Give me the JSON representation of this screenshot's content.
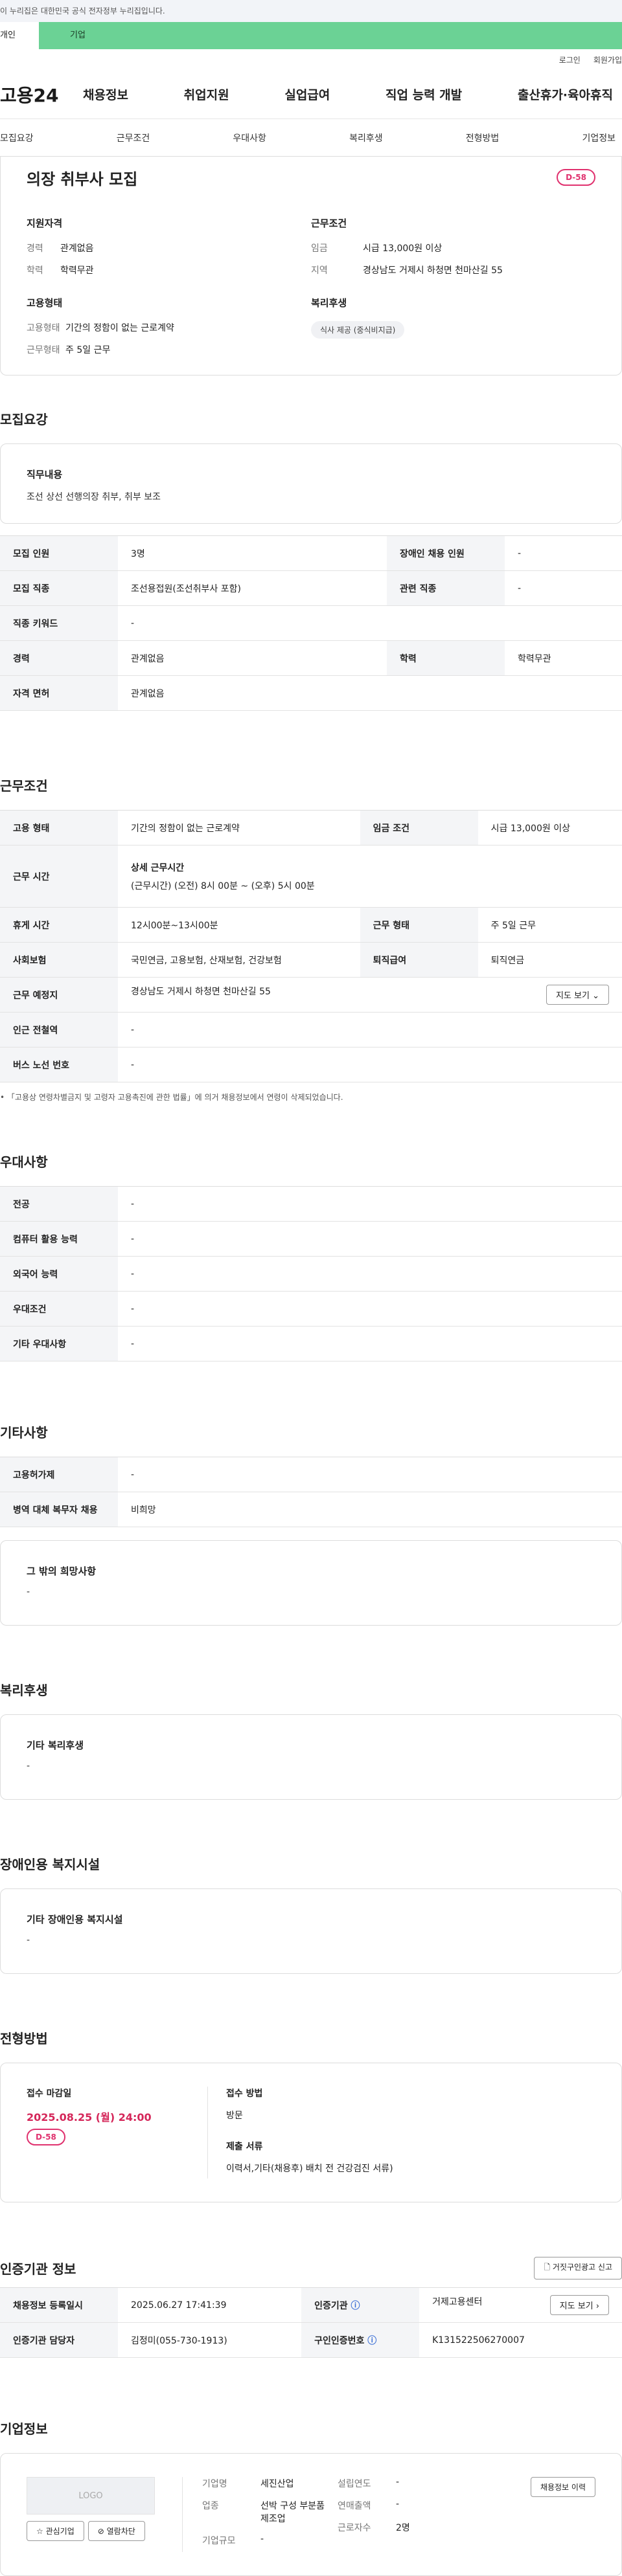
{
  "notice": "이 누리집은 대한민국 공식 전자정부 누리집입니다.",
  "top_tabs": [
    "개인",
    "기업"
  ],
  "util": [
    "로그인",
    "회원가입"
  ],
  "logo": "고용24",
  "gnb": [
    "채용정보",
    "취업지원",
    "실업급여",
    "직업 능력 개발",
    "출산휴가·육아휴직"
  ],
  "anchors": [
    "모집요강",
    "근무조건",
    "우대사항",
    "복리후생",
    "전형방법",
    "기업정보"
  ],
  "summary": {
    "title": "의장 취부사 모집",
    "dday": "D-58",
    "req_title": "지원자격",
    "career_k": "경력",
    "career_v": "관계없음",
    "edu_k": "학력",
    "edu_v": "학력무관",
    "cond_title": "근무조건",
    "wage_k": "임금",
    "wage_v": "시급 13,000원 이상",
    "loc_k": "지역",
    "loc_v": "경상남도 거제시 하청면 천마산길 55",
    "emp_title": "고용형태",
    "emptype_k": "고용형태",
    "emptype_v": "기간의 정함이 없는 근로계약",
    "worktype_k": "근무형태",
    "worktype_v": "주 5일 근무",
    "welfare_title": "복리후생",
    "welfare_tag": "식사 제공 (중식비지급)"
  },
  "recruit": {
    "title": "모집요강",
    "job_h": "직무내용",
    "job_v": "조선 상선 선행의장 취부, 취부 보조",
    "rows": [
      [
        "모집 인원",
        "3명",
        "장애인 채용 인원",
        "-"
      ],
      [
        "모집 직종",
        "조선용접원(조선취부사 포함)",
        "관련 직종",
        "-"
      ],
      [
        "직종 키워드",
        "-"
      ],
      [
        "경력",
        "관계없음",
        "학력",
        "학력무관"
      ],
      [
        "자격 면허",
        "관계없음"
      ]
    ]
  },
  "work": {
    "title": "근무조건",
    "emp_k": "고용 형태",
    "emp_v": "기간의 정함이 없는 근로계약",
    "wage_k": "임금 조건",
    "wage_v": "시급 13,000원 이상",
    "time_k": "근무 시간",
    "time_h": "상세 근무시간",
    "time_v": "(근무시간) (오전) 8시 00분 ~ (오후) 5시 00분",
    "rest_k": "휴게 시간",
    "rest_v": "12시00분~13시00분",
    "form_k": "근무 형태",
    "form_v": "주 5일 근무",
    "ins_k": "사회보험",
    "ins_v": "국민연금, 고용보험, 산재보험, 건강보험",
    "ret_k": "퇴직급여",
    "ret_v": "퇴직연금",
    "place_k": "근무 예정지",
    "place_v": "경상남도 거제시 하청면 천마산길 55",
    "map": "지도 보기",
    "sub_k": "인근 전철역",
    "sub_v": "-",
    "bus_k": "버스 노선 번호",
    "bus_v": "-",
    "note": "「고용상 연령차별금지 및 고령자 고용촉진에 관한 법률」에 의거 채용정보에서 연령이 삭제되었습니다."
  },
  "pref": {
    "title": "우대사항",
    "rows": [
      [
        "전공",
        "-"
      ],
      [
        "컴퓨터 활용 능력",
        "-"
      ],
      [
        "외국어 능력",
        "-"
      ],
      [
        "우대조건",
        "-"
      ],
      [
        "기타 우대사항",
        "-"
      ]
    ]
  },
  "etc": {
    "title": "기타사항",
    "rows": [
      [
        "고용허가제",
        "-"
      ],
      [
        "병역 대체 복무자 채용",
        "비희망"
      ]
    ],
    "wish_h": "그 밖의 희망사항",
    "wish_v": "-"
  },
  "welfare": {
    "title": "복리후생",
    "h": "기타 복리후생",
    "v": "-"
  },
  "disab": {
    "title": "장애인용 복지시설",
    "h": "기타 장애인용 복지시설",
    "v": "-"
  },
  "process": {
    "title": "전형방법",
    "deadline_h": "접수 마감일",
    "deadline_v": "2025.08.25 (월) 24:00",
    "dday": "D-58",
    "method_h": "접수 방법",
    "method_v": "방문",
    "docs_h": "제출 서류",
    "docs_v": "이력서,기타(채용후) 배치 전 건강검진 서류)"
  },
  "cert": {
    "title": "인증기관 정보",
    "report": "거짓구인광고 신고",
    "reg_k": "채용정보 등록일시",
    "reg_v": "2025.06.27 17:41:39",
    "org_k": "인증기관",
    "org_v": "거제고용센터",
    "map": "지도 보기",
    "mgr_k": "인증기관 담당자",
    "mgr_v": "김정미(055-730-1913)",
    "cert_k": "구인인증번호",
    "cert_v": "K131522506270007"
  },
  "company": {
    "title": "기업정보",
    "logo": "LOGO",
    "fav": "관심기업",
    "block": "열람차단",
    "name_k": "기업명",
    "name_v": "세진산업",
    "ind_k": "업종",
    "ind_v": "선박 구성 부분품 제조업",
    "size_k": "기업규모",
    "size_v": "-",
    "year_k": "설립연도",
    "year_v": "-",
    "sales_k": "연매출액",
    "sales_v": "-",
    "emp_k": "근로자수",
    "emp_v": "2명",
    "history": "채용정보 이력"
  }
}
